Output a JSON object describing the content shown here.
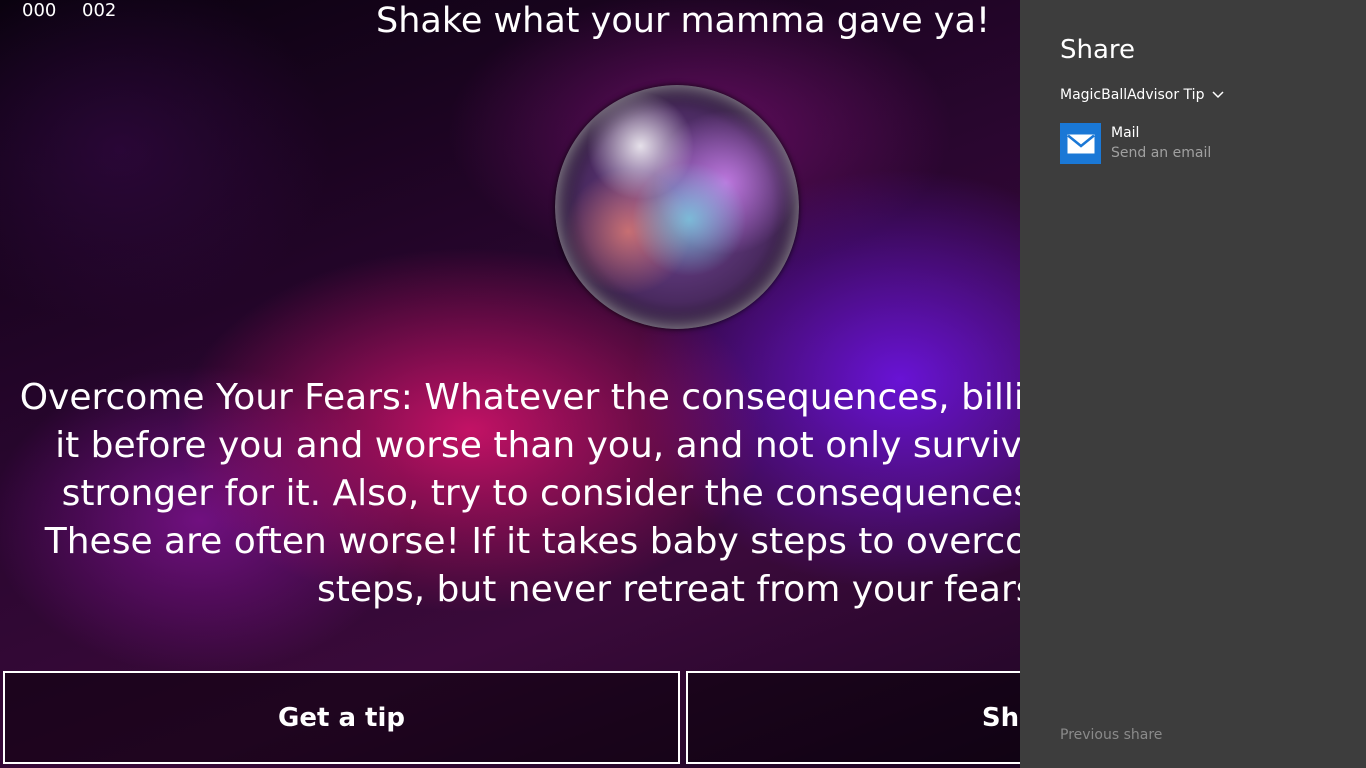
{
  "app": {
    "counter_left": "000",
    "counter_right": "002",
    "headline": "Shake what your mamma gave ya!",
    "tip": "Overcome Your Fears: Whatever the consequences, billions have suffered it before you and worse than you, and not only survived but emerged stronger for it. Also, try to consider the consequences of NOT acting! These are often worse! If it takes baby steps to overcome it, take baby steps, but never retreat from your fears!",
    "buttons": {
      "get_tip": "Get a tip",
      "share": "Share"
    }
  },
  "share_pane": {
    "title": "Share",
    "source": "MagicBallAdvisor Tip",
    "targets": [
      {
        "name": "Mail",
        "description": "Send an email",
        "icon": "mail-icon",
        "tile_color": "#1a78d6"
      }
    ],
    "previous_share": "Previous share"
  },
  "colors": {
    "pane_background": "#3d3d3d",
    "text": "#ffffff",
    "muted_text": "#a0a0a0"
  }
}
